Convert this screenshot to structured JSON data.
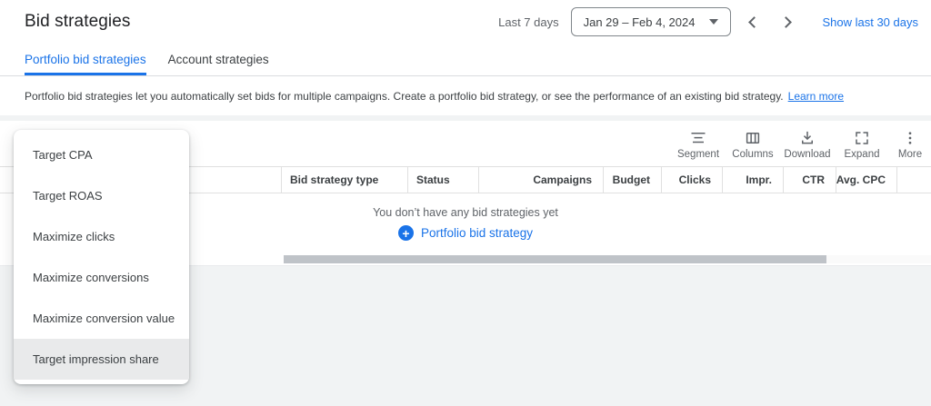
{
  "header": {
    "title": "Bid strategies",
    "range_label": "Last 7 days",
    "date_value": "Jan 29 – Feb 4, 2024",
    "show_last_label": "Show last 30 days"
  },
  "tabs": [
    {
      "label": "Portfolio bid strategies",
      "active": true
    },
    {
      "label": "Account strategies",
      "active": false
    }
  ],
  "description": {
    "text": "Portfolio bid strategies let you automatically set bids for multiple campaigns. Create a portfolio bid strategy, or see the performance of an existing bid strategy.",
    "link_label": "Learn more"
  },
  "toolbar": {
    "buttons": [
      {
        "label": "Segment",
        "icon": "segment-icon"
      },
      {
        "label": "Columns",
        "icon": "columns-icon"
      },
      {
        "label": "Download",
        "icon": "download-icon"
      },
      {
        "label": "Expand",
        "icon": "expand-icon"
      },
      {
        "label": "More",
        "icon": "more-icon"
      }
    ]
  },
  "table": {
    "columns": [
      {
        "label": "Bid strategy type",
        "align": "left",
        "width": 139
      },
      {
        "label": "Status",
        "align": "left",
        "width": 78
      },
      {
        "label": "Campaigns",
        "align": "right",
        "width": 137
      },
      {
        "label": "Budget",
        "align": "right",
        "width": 64
      },
      {
        "label": "Clicks",
        "align": "right",
        "width": 67
      },
      {
        "label": "Impr.",
        "align": "right",
        "width": 67
      },
      {
        "label": "CTR",
        "align": "right",
        "width": 58
      },
      {
        "label": "Avg. CPC",
        "align": "right",
        "width": 67
      }
    ],
    "empty": {
      "message": "You don’t have any bid strategies yet",
      "action_label": "Portfolio bid strategy",
      "action_icon": "plus-circle-icon"
    }
  },
  "type_menu": {
    "items": [
      {
        "label": "Target CPA",
        "highlighted": false
      },
      {
        "label": "Target ROAS",
        "highlighted": false
      },
      {
        "label": "Maximize clicks",
        "highlighted": false
      },
      {
        "label": "Maximize conversions",
        "highlighted": false
      },
      {
        "label": "Maximize conversion value",
        "highlighted": false
      },
      {
        "label": "Target impression share",
        "highlighted": true
      }
    ]
  },
  "colors": {
    "accent_blue": "#1a73e8",
    "text_primary": "#202124",
    "text_secondary": "#5f6368",
    "tab_border": "#dadce0",
    "table_border": "#e0e0e0",
    "page_background": "#f1f3f4",
    "menu_highlight": "#e9eaeb",
    "scrollbar_thumb": "#bfc3c8"
  }
}
